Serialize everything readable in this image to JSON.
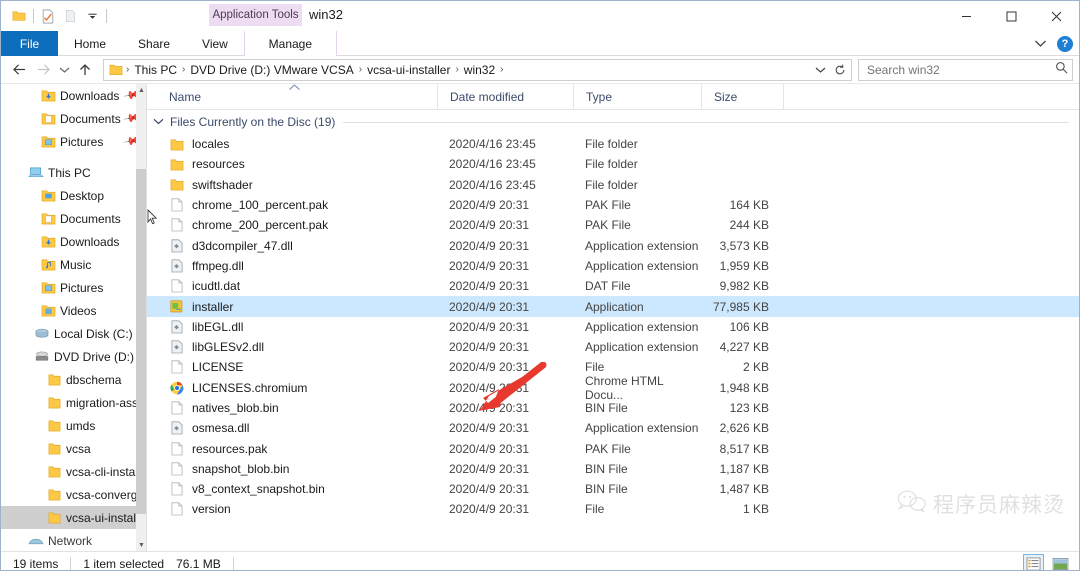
{
  "window": {
    "title": "win32",
    "contextual_tab_group": "Application Tools",
    "controls": {
      "minimize": "─",
      "maximize": "☐",
      "close": "✕"
    }
  },
  "quick_access_toolbar": {
    "items": [
      {
        "name": "folder-icon",
        "label": "Folder"
      },
      {
        "name": "properties-icon",
        "label": "Properties"
      },
      {
        "name": "new-folder-icon",
        "label": "New folder"
      },
      {
        "name": "chevron-down-icon",
        "label": "Customize Quick Access Toolbar"
      }
    ]
  },
  "ribbon": {
    "tabs": [
      {
        "id": "file",
        "label": "File"
      },
      {
        "id": "home",
        "label": "Home"
      },
      {
        "id": "share",
        "label": "Share"
      },
      {
        "id": "view",
        "label": "View"
      },
      {
        "id": "manage",
        "label": "Manage"
      }
    ],
    "active_tab": "File",
    "expand_label": "⌄",
    "help_label": "?"
  },
  "addressbar": {
    "back": "←",
    "forward": "→",
    "recent": "⌄",
    "up": "↑",
    "crumbs": [
      "This PC",
      "DVD Drive (D:) VMware VCSA",
      "vcsa-ui-installer",
      "win32"
    ],
    "separator": "›",
    "dropdown": "⌄",
    "refresh": "↻"
  },
  "search": {
    "placeholder": "Search win32",
    "value": "",
    "icon": "search-icon"
  },
  "sidebar": {
    "quick_access": [
      {
        "label": "Downloads",
        "icon": "folder-download-icon",
        "pinned": true
      },
      {
        "label": "Documents",
        "icon": "folder-documents-icon",
        "pinned": true
      },
      {
        "label": "Pictures",
        "icon": "folder-pictures-icon",
        "pinned": true
      }
    ],
    "this_pc": {
      "label": "This PC",
      "icon": "this-pc-icon",
      "children": [
        {
          "label": "Desktop",
          "icon": "folder-desktop-icon"
        },
        {
          "label": "Documents",
          "icon": "folder-documents-icon"
        },
        {
          "label": "Downloads",
          "icon": "folder-download-icon"
        },
        {
          "label": "Music",
          "icon": "folder-music-icon"
        },
        {
          "label": "Pictures",
          "icon": "folder-pictures-icon"
        },
        {
          "label": "Videos",
          "icon": "folder-videos-icon"
        },
        {
          "label": "Local Disk (C:)",
          "icon": "hard-disk-icon"
        }
      ]
    },
    "dvd_drive": {
      "label": "DVD Drive (D:) V",
      "icon": "dvd-drive-icon",
      "children": [
        {
          "label": "dbschema",
          "icon": "folder-icon"
        },
        {
          "label": "migration-assis",
          "icon": "folder-icon"
        },
        {
          "label": "umds",
          "icon": "folder-icon"
        },
        {
          "label": "vcsa",
          "icon": "folder-icon"
        },
        {
          "label": "vcsa-cli-installe",
          "icon": "folder-icon"
        },
        {
          "label": "vcsa-converge-",
          "icon": "folder-icon"
        },
        {
          "label": "vcsa-ui-installe",
          "icon": "folder-icon",
          "selected": true
        }
      ]
    },
    "network": {
      "label": "Network",
      "icon": "network-icon"
    }
  },
  "filelist": {
    "columns": [
      {
        "key": "name",
        "label": "Name",
        "sorted": true,
        "sort_dir": "asc"
      },
      {
        "key": "date",
        "label": "Date modified"
      },
      {
        "key": "type",
        "label": "Type"
      },
      {
        "key": "size",
        "label": "Size"
      }
    ],
    "group_header": "Files Currently on the Disc (19)",
    "group_collapsed": false,
    "rows": [
      {
        "name": "locales",
        "date": "2020/4/16 23:45",
        "type": "File folder",
        "size": "",
        "icon": "folder-icon",
        "selected": false
      },
      {
        "name": "resources",
        "date": "2020/4/16 23:45",
        "type": "File folder",
        "size": "",
        "icon": "folder-icon",
        "selected": false
      },
      {
        "name": "swiftshader",
        "date": "2020/4/16 23:45",
        "type": "File folder",
        "size": "",
        "icon": "folder-icon",
        "selected": false
      },
      {
        "name": "chrome_100_percent.pak",
        "date": "2020/4/9 20:31",
        "type": "PAK File",
        "size": "164 KB",
        "icon": "generic-file-icon",
        "selected": false
      },
      {
        "name": "chrome_200_percent.pak",
        "date": "2020/4/9 20:31",
        "type": "PAK File",
        "size": "244 KB",
        "icon": "generic-file-icon",
        "selected": false
      },
      {
        "name": "d3dcompiler_47.dll",
        "date": "2020/4/9 20:31",
        "type": "Application extension",
        "size": "3,573 KB",
        "icon": "dll-file-icon",
        "selected": false
      },
      {
        "name": "ffmpeg.dll",
        "date": "2020/4/9 20:31",
        "type": "Application extension",
        "size": "1,959 KB",
        "icon": "dll-file-icon",
        "selected": false
      },
      {
        "name": "icudtl.dat",
        "date": "2020/4/9 20:31",
        "type": "DAT File",
        "size": "9,982 KB",
        "icon": "generic-file-icon",
        "selected": false
      },
      {
        "name": "installer",
        "date": "2020/4/9 20:31",
        "type": "Application",
        "size": "77,985 KB",
        "icon": "application-icon",
        "selected": true
      },
      {
        "name": "libEGL.dll",
        "date": "2020/4/9 20:31",
        "type": "Application extension",
        "size": "106 KB",
        "icon": "dll-file-icon",
        "selected": false
      },
      {
        "name": "libGLESv2.dll",
        "date": "2020/4/9 20:31",
        "type": "Application extension",
        "size": "4,227 KB",
        "icon": "dll-file-icon",
        "selected": false
      },
      {
        "name": "LICENSE",
        "date": "2020/4/9 20:31",
        "type": "File",
        "size": "2 KB",
        "icon": "generic-file-icon",
        "selected": false
      },
      {
        "name": "LICENSES.chromium",
        "date": "2020/4/9 20:31",
        "type": "Chrome HTML Docu...",
        "size": "1,948 KB",
        "icon": "chrome-icon",
        "selected": false
      },
      {
        "name": "natives_blob.bin",
        "date": "2020/4/9 20:31",
        "type": "BIN File",
        "size": "123 KB",
        "icon": "generic-file-icon",
        "selected": false
      },
      {
        "name": "osmesa.dll",
        "date": "2020/4/9 20:31",
        "type": "Application extension",
        "size": "2,626 KB",
        "icon": "dll-file-icon",
        "selected": false
      },
      {
        "name": "resources.pak",
        "date": "2020/4/9 20:31",
        "type": "PAK File",
        "size": "8,517 KB",
        "icon": "generic-file-icon",
        "selected": false
      },
      {
        "name": "snapshot_blob.bin",
        "date": "2020/4/9 20:31",
        "type": "BIN File",
        "size": "1,187 KB",
        "icon": "generic-file-icon",
        "selected": false
      },
      {
        "name": "v8_context_snapshot.bin",
        "date": "2020/4/9 20:31",
        "type": "BIN File",
        "size": "1,487 KB",
        "icon": "generic-file-icon",
        "selected": false
      },
      {
        "name": "version",
        "date": "2020/4/9 20:31",
        "type": "File",
        "size": "1 KB",
        "icon": "generic-file-icon",
        "selected": false
      }
    ]
  },
  "statusbar": {
    "item_count": "19 items",
    "selection": "1 item selected",
    "selection_size": "76.1 MB",
    "views": [
      {
        "name": "details-view-button",
        "active": true
      },
      {
        "name": "large-icons-view-button",
        "active": false
      }
    ]
  },
  "annotation": {
    "arrow": "red-arrow-pointing-to-installer",
    "color": "#e8392f"
  },
  "watermark": {
    "text": "程序员麻辣烫",
    "icon": "wechat-icon"
  },
  "colors": {
    "file_tab": "#0c6ebd",
    "selection": "#cce8ff",
    "contextual_tab": "#eedcf3",
    "column_header_text": "#3b4a6b",
    "folder_yellow": "#fdc846",
    "accent_red": "#e8392f"
  }
}
